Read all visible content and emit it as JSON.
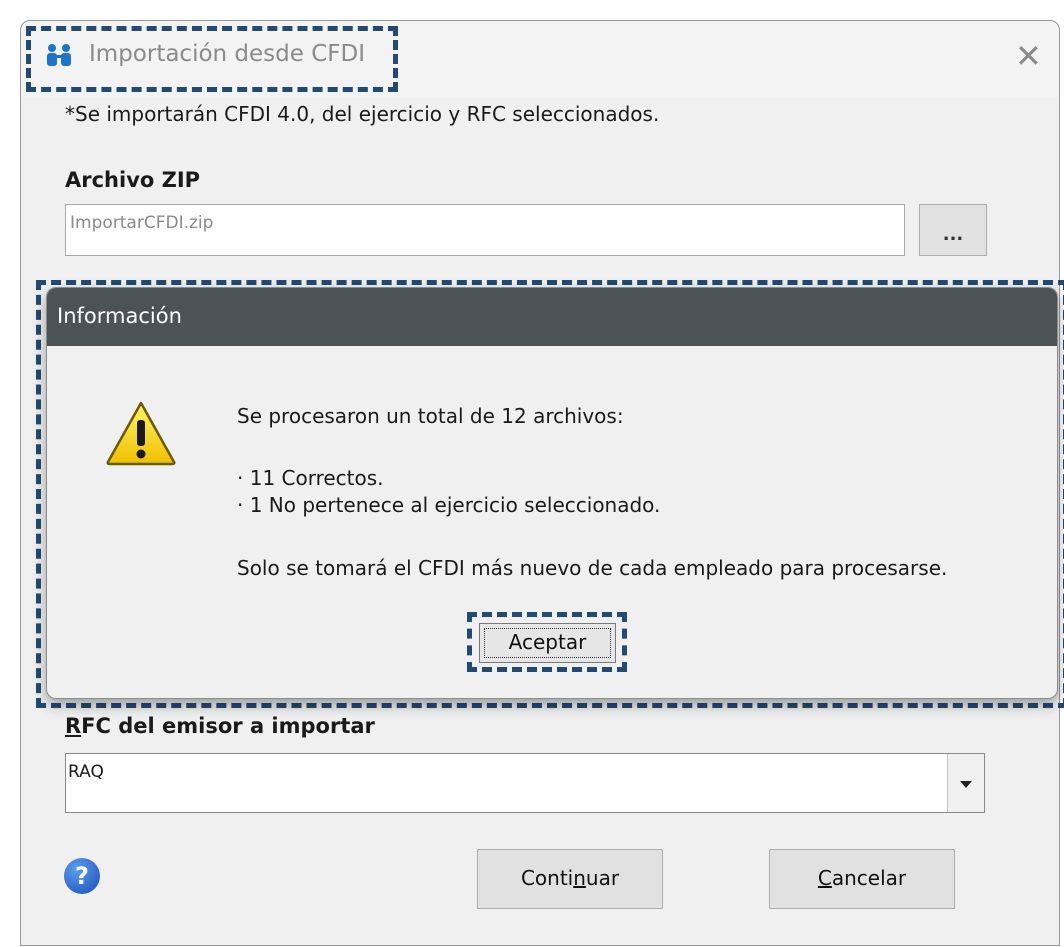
{
  "window": {
    "title": "Importación desde CFDI",
    "close_glyph": "✕",
    "app_icon": "people-icon"
  },
  "form": {
    "note": "*Se importarán CFDI 4.0, del ejercicio y RFC seleccionados.",
    "zip_label": "Archivo ZIP",
    "zip_value": "ImportarCFDI.zip",
    "browse_label": "...",
    "rfc_label_accel": "R",
    "rfc_label_rest": "FC del emisor a importar",
    "rfc_value": "RAQ",
    "help_glyph": "?",
    "continue_pre": "Conti",
    "continue_accel": "n",
    "continue_post": "uar",
    "cancel_accel": "C",
    "cancel_rest": "ancelar"
  },
  "info_dialog": {
    "title": "Información",
    "icon": "warning-icon",
    "line1": "Se procesaron un total de 12 archivos:",
    "line2": "· 11 Correctos.",
    "line3": "· 1 No pertenece al ejercicio seleccionado.",
    "line4": "Solo se tomará el CFDI más nuevo de cada empleado para procesarse.",
    "ok_label": "Aceptar"
  },
  "colors": {
    "highlight": "#234a72",
    "info_titlebar": "#4c5357"
  }
}
